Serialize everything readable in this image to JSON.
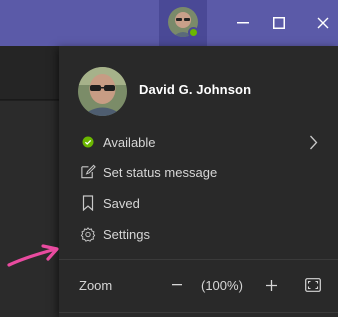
{
  "titlebar": {
    "avatar_icon": "user-avatar",
    "presence_color": "#6bb700",
    "accent_color": "#5b5aa8"
  },
  "profile": {
    "name": "David G. Johnson"
  },
  "menu": {
    "available_label": "Available",
    "set_status_label": "Set status message",
    "saved_label": "Saved",
    "settings_label": "Settings"
  },
  "zoom": {
    "label": "Zoom",
    "minus": "−",
    "level": "(100%)",
    "plus": "+"
  },
  "annotation": {
    "arrow_color": "#e94ba0"
  }
}
